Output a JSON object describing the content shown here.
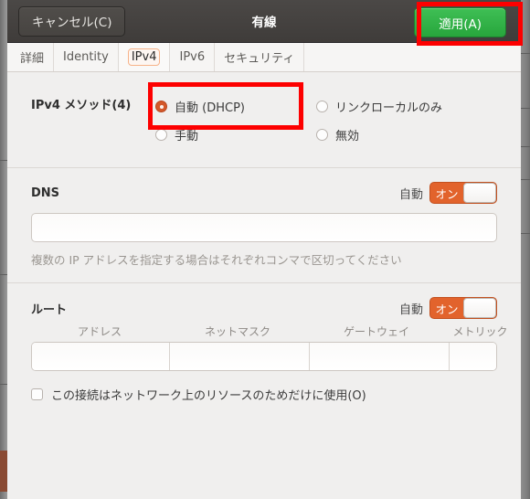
{
  "window": {
    "title": "有線",
    "cancel_label": "キャンセル(C)",
    "apply_label": "適用(A)"
  },
  "tabs": [
    {
      "label": "詳細",
      "name": "tab-details",
      "selected": false
    },
    {
      "label": "Identity",
      "name": "tab-identity",
      "selected": false
    },
    {
      "label": "IPv4",
      "name": "tab-ipv4",
      "selected": true
    },
    {
      "label": "IPv6",
      "name": "tab-ipv6",
      "selected": false
    },
    {
      "label": "セキュリティ",
      "name": "tab-security",
      "selected": false
    }
  ],
  "method": {
    "label": "IPv4 メソッド(4)",
    "options": [
      {
        "label": "自動 (DHCP)",
        "checked": true
      },
      {
        "label": "リンクローカルのみ",
        "checked": false
      },
      {
        "label": "手動",
        "checked": false
      },
      {
        "label": "無効",
        "checked": false
      }
    ]
  },
  "dns": {
    "title": "DNS",
    "auto_label": "自動",
    "switch_state": "オン",
    "value": "",
    "placeholder": "",
    "hint": "複数の IP アドレスを指定する場合はそれぞれコンマで区切ってください"
  },
  "routes": {
    "title": "ルート",
    "auto_label": "自動",
    "switch_state": "オン",
    "columns": [
      "アドレス",
      "ネットマスク",
      "ゲートウェイ",
      "メトリック"
    ],
    "rows": [
      {
        "address": "",
        "netmask": "",
        "gateway": "",
        "metric": ""
      }
    ],
    "delete_icon": "close-circle-icon"
  },
  "shared": {
    "label": "この接続はネットワーク上のリソースのためだけに使用(O)",
    "checked": false
  },
  "colors": {
    "accent_orange": "#e2632c",
    "radio_selected": "#d4582a",
    "apply_green": "#27a63c",
    "annotation_red": "#fd0000",
    "headerbar": "#423f3d",
    "content_bg": "#f0efee"
  }
}
